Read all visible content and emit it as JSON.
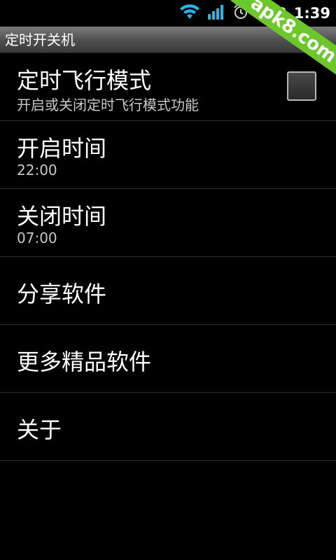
{
  "status_bar": {
    "battery": "100",
    "time": "1:39",
    "icons": [
      "wifi-icon",
      "signal-icon",
      "alarm-icon"
    ]
  },
  "watermark": {
    "text": "apk8.com"
  },
  "title_bar": {
    "title": "定时开关机"
  },
  "settings": {
    "items": [
      {
        "title": "定时飞行模式",
        "summary": "开启或关闭定时飞行模式功能",
        "checked": false
      },
      {
        "title": "开启时间",
        "summary": "22:00"
      },
      {
        "title": "关闭时间",
        "summary": "07:00"
      },
      {
        "title": "分享软件"
      },
      {
        "title": "更多精品软件"
      },
      {
        "title": "关于"
      }
    ]
  },
  "colors": {
    "background": "#000000",
    "accent_watermark": "#6cc82a",
    "status_icons": "#2ab4e6"
  }
}
